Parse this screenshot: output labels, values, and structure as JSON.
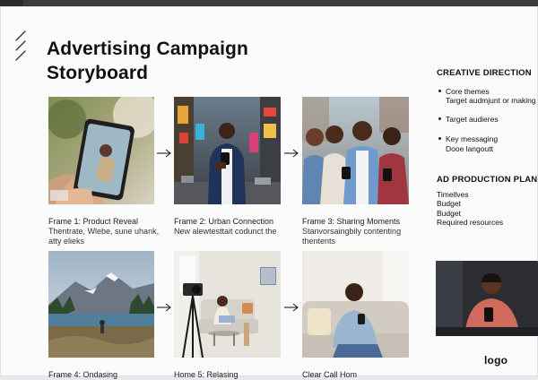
{
  "title_line1": "Advertising Campaign",
  "title_line2": "Storyboard",
  "frames": [
    {
      "caption": "Frame 1: Product Reveal",
      "sub1": "Thentrate, Wlebe, sune uhank,",
      "sub2": "atty elieks"
    },
    {
      "caption": "Frame 2: Urban Connection",
      "sub1": "New alewtesttait codunct the",
      "sub2": ""
    },
    {
      "caption": "Frame 3: Sharing Moments",
      "sub1": "Stanvorsaingbily contenting",
      "sub2": "thentents"
    },
    {
      "caption": "Frame 4: Ondasing",
      "sub1": "",
      "sub2": ""
    },
    {
      "caption": "Home 5: Relasing",
      "sub1": "",
      "sub2": ""
    },
    {
      "caption": "Clear Call Hom",
      "sub1": "",
      "sub2": ""
    }
  ],
  "creative_direction": {
    "heading": "CREATIVE DIRECTION",
    "bullets": [
      {
        "text": "Core themes",
        "detail": "Target audmjunt or making"
      },
      {
        "text": "Target audieres",
        "detail": ""
      },
      {
        "text": "Key messaging",
        "detail": "Dooe langoutt"
      }
    ]
  },
  "ad_production": {
    "heading": "AD PRODUCTION PLANNING",
    "items": [
      "Timellves",
      "Budget",
      "Budget",
      "Required resources"
    ]
  },
  "logo": "logo",
  "icons": {
    "hatch": "hatch-marks-icon",
    "arrow": "arrow-right-icon"
  }
}
